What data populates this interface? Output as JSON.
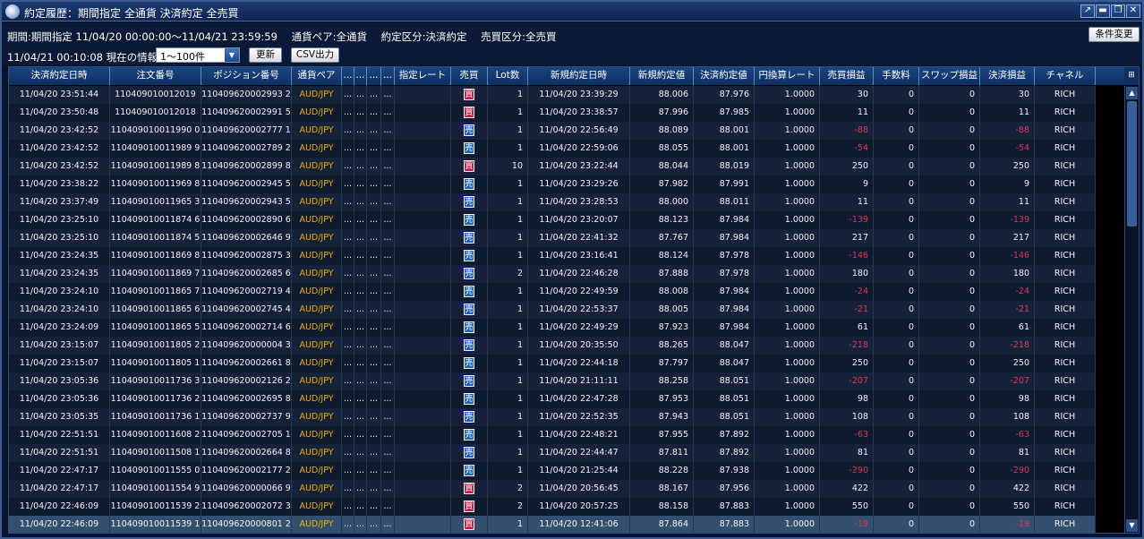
{
  "window": {
    "title": "約定履歴：期間指定 全通貨 決済約定 全売買",
    "controls": [
      "↗",
      "▬",
      "❐",
      "✕"
    ]
  },
  "info": {
    "period": "期間:期間指定  11/04/20 00:00:00〜11/04/21 23:59:59",
    "currency_pair": "通貨ペア:全通貨",
    "trade_type": "約定区分:決済約定",
    "buy_sell": "売買区分:全売買",
    "current_info": "11/04/21 00:10:08 現在の情報",
    "range_value": "1〜100件",
    "update_label": "更新",
    "csv_label": "CSV出力",
    "condition_label": "条件変更"
  },
  "columns": [
    "決済約定日時",
    "注文番号",
    "ポジション番号",
    "通貨ペア",
    "...",
    "...",
    "...",
    "...",
    "指定レート",
    "売買",
    "Lot数",
    "新規約定日時",
    "新規約定値",
    "決済約定値",
    "円換算レート",
    "売買損益",
    "手数料",
    "スワップ損益",
    "決済損益",
    "チャネル"
  ],
  "rows": [
    {
      "time": "11/04/20 23:51:44",
      "order": "110409010012019",
      "position": "110409620002993 2",
      "pair": "AUD/JPY",
      "side": "買",
      "side_type": "buy",
      "lots": "1",
      "open_time": "11/04/20 23:39:29",
      "open_price": "88.006",
      "close_price": "87.976",
      "jpy_rate": "1.0000",
      "pl": "30",
      "fee": "0",
      "swap": "0",
      "net": "30",
      "channel": "RICH"
    },
    {
      "time": "11/04/20 23:50:48",
      "order": "110409010012018",
      "position": "110409620002991 5",
      "pair": "AUD/JPY",
      "side": "買",
      "side_type": "buy",
      "lots": "1",
      "open_time": "11/04/20 23:38:57",
      "open_price": "87.996",
      "close_price": "87.985",
      "jpy_rate": "1.0000",
      "pl": "11",
      "fee": "0",
      "swap": "0",
      "net": "11",
      "channel": "RICH"
    },
    {
      "time": "11/04/20 23:42:52",
      "order": "110409010011990 0",
      "position": "110409620002777 1",
      "pair": "AUD/JPY",
      "side": "売",
      "side_type": "sell",
      "lots": "1",
      "open_time": "11/04/20 22:56:49",
      "open_price": "88.089",
      "close_price": "88.001",
      "jpy_rate": "1.0000",
      "pl": "-88",
      "fee": "0",
      "swap": "0",
      "net": "-88",
      "channel": "RICH"
    },
    {
      "time": "11/04/20 23:42:52",
      "order": "110409010011989 9",
      "position": "110409620002789 2",
      "pair": "AUD/JPY",
      "side": "売",
      "side_type": "sell",
      "lots": "1",
      "open_time": "11/04/20 22:59:06",
      "open_price": "88.055",
      "close_price": "88.001",
      "jpy_rate": "1.0000",
      "pl": "-54",
      "fee": "0",
      "swap": "0",
      "net": "-54",
      "channel": "RICH"
    },
    {
      "time": "11/04/20 23:42:52",
      "order": "110409010011989 8",
      "position": "110409620002899 8",
      "pair": "AUD/JPY",
      "side": "買",
      "side_type": "buy",
      "lots": "10",
      "open_time": "11/04/20 23:22:44",
      "open_price": "88.044",
      "close_price": "88.019",
      "jpy_rate": "1.0000",
      "pl": "250",
      "fee": "0",
      "swap": "0",
      "net": "250",
      "channel": "RICH"
    },
    {
      "time": "11/04/20 23:38:22",
      "order": "110409010011969 8",
      "position": "110409620002945 5",
      "pair": "AUD/JPY",
      "side": "売",
      "side_type": "sell",
      "lots": "1",
      "open_time": "11/04/20 23:29:26",
      "open_price": "87.982",
      "close_price": "87.991",
      "jpy_rate": "1.0000",
      "pl": "9",
      "fee": "0",
      "swap": "0",
      "net": "9",
      "channel": "RICH"
    },
    {
      "time": "11/04/20 23:37:49",
      "order": "110409010011965 3",
      "position": "110409620002943 5",
      "pair": "AUD/JPY",
      "side": "売",
      "side_type": "sell",
      "lots": "1",
      "open_time": "11/04/20 23:28:53",
      "open_price": "88.000",
      "close_price": "88.011",
      "jpy_rate": "1.0000",
      "pl": "11",
      "fee": "0",
      "swap": "0",
      "net": "11",
      "channel": "RICH"
    },
    {
      "time": "11/04/20 23:25:10",
      "order": "110409010011874 6",
      "position": "110409620002890 6",
      "pair": "AUD/JPY",
      "side": "売",
      "side_type": "sell",
      "lots": "1",
      "open_time": "11/04/20 23:20:07",
      "open_price": "88.123",
      "close_price": "87.984",
      "jpy_rate": "1.0000",
      "pl": "-139",
      "fee": "0",
      "swap": "0",
      "net": "-139",
      "channel": "RICH"
    },
    {
      "time": "11/04/20 23:25:10",
      "order": "110409010011874 5",
      "position": "110409620002646 9",
      "pair": "AUD/JPY",
      "side": "売",
      "side_type": "sell",
      "lots": "1",
      "open_time": "11/04/20 22:41:32",
      "open_price": "87.767",
      "close_price": "87.984",
      "jpy_rate": "1.0000",
      "pl": "217",
      "fee": "0",
      "swap": "0",
      "net": "217",
      "channel": "RICH"
    },
    {
      "time": "11/04/20 23:24:35",
      "order": "110409010011869 8",
      "position": "110409620002875 3",
      "pair": "AUD/JPY",
      "side": "売",
      "side_type": "sell",
      "lots": "1",
      "open_time": "11/04/20 23:16:41",
      "open_price": "88.124",
      "close_price": "87.978",
      "jpy_rate": "1.0000",
      "pl": "-146",
      "fee": "0",
      "swap": "0",
      "net": "-146",
      "channel": "RICH"
    },
    {
      "time": "11/04/20 23:24:35",
      "order": "110409010011869 7",
      "position": "110409620002685 6",
      "pair": "AUD/JPY",
      "side": "売",
      "side_type": "sell",
      "lots": "2",
      "open_time": "11/04/20 22:46:28",
      "open_price": "87.888",
      "close_price": "87.978",
      "jpy_rate": "1.0000",
      "pl": "180",
      "fee": "0",
      "swap": "0",
      "net": "180",
      "channel": "RICH"
    },
    {
      "time": "11/04/20 23:24:10",
      "order": "110409010011865 7",
      "position": "110409620002719 4",
      "pair": "AUD/JPY",
      "side": "売",
      "side_type": "sell",
      "lots": "1",
      "open_time": "11/04/20 22:49:59",
      "open_price": "88.008",
      "close_price": "87.984",
      "jpy_rate": "1.0000",
      "pl": "-24",
      "fee": "0",
      "swap": "0",
      "net": "-24",
      "channel": "RICH"
    },
    {
      "time": "11/04/20 23:24:10",
      "order": "110409010011865 6",
      "position": "110409620002745 4",
      "pair": "AUD/JPY",
      "side": "売",
      "side_type": "sell",
      "lots": "1",
      "open_time": "11/04/20 22:53:37",
      "open_price": "88.005",
      "close_price": "87.984",
      "jpy_rate": "1.0000",
      "pl": "-21",
      "fee": "0",
      "swap": "0",
      "net": "-21",
      "channel": "RICH"
    },
    {
      "time": "11/04/20 23:24:09",
      "order": "110409010011865 5",
      "position": "110409620002714 6",
      "pair": "AUD/JPY",
      "side": "売",
      "side_type": "sell",
      "lots": "1",
      "open_time": "11/04/20 22:49:29",
      "open_price": "87.923",
      "close_price": "87.984",
      "jpy_rate": "1.0000",
      "pl": "61",
      "fee": "0",
      "swap": "0",
      "net": "61",
      "channel": "RICH"
    },
    {
      "time": "11/04/20 23:15:07",
      "order": "110409010011805 2",
      "position": "110409620000004 3",
      "pair": "AUD/JPY",
      "side": "売",
      "side_type": "sell",
      "lots": "1",
      "open_time": "11/04/20 20:35:50",
      "open_price": "88.265",
      "close_price": "88.047",
      "jpy_rate": "1.0000",
      "pl": "-218",
      "fee": "0",
      "swap": "0",
      "net": "-218",
      "channel": "RICH"
    },
    {
      "time": "11/04/20 23:15:07",
      "order": "110409010011805 1",
      "position": "110409620002661 8",
      "pair": "AUD/JPY",
      "side": "売",
      "side_type": "sell",
      "lots": "1",
      "open_time": "11/04/20 22:44:18",
      "open_price": "87.797",
      "close_price": "88.047",
      "jpy_rate": "1.0000",
      "pl": "250",
      "fee": "0",
      "swap": "0",
      "net": "250",
      "channel": "RICH"
    },
    {
      "time": "11/04/20 23:05:36",
      "order": "110409010011736 3",
      "position": "110409620002126 2",
      "pair": "AUD/JPY",
      "side": "売",
      "side_type": "sell",
      "lots": "1",
      "open_time": "11/04/20 21:11:11",
      "open_price": "88.258",
      "close_price": "88.051",
      "jpy_rate": "1.0000",
      "pl": "-207",
      "fee": "0",
      "swap": "0",
      "net": "-207",
      "channel": "RICH"
    },
    {
      "time": "11/04/20 23:05:36",
      "order": "110409010011736 2",
      "position": "110409620002695 8",
      "pair": "AUD/JPY",
      "side": "売",
      "side_type": "sell",
      "lots": "1",
      "open_time": "11/04/20 22:47:28",
      "open_price": "87.953",
      "close_price": "88.051",
      "jpy_rate": "1.0000",
      "pl": "98",
      "fee": "0",
      "swap": "0",
      "net": "98",
      "channel": "RICH"
    },
    {
      "time": "11/04/20 23:05:35",
      "order": "110409010011736 1",
      "position": "110409620002737 9",
      "pair": "AUD/JPY",
      "side": "売",
      "side_type": "sell",
      "lots": "1",
      "open_time": "11/04/20 22:52:35",
      "open_price": "87.943",
      "close_price": "88.051",
      "jpy_rate": "1.0000",
      "pl": "108",
      "fee": "0",
      "swap": "0",
      "net": "108",
      "channel": "RICH"
    },
    {
      "time": "11/04/20 22:51:51",
      "order": "110409010011608 2",
      "position": "110409620002705 1",
      "pair": "AUD/JPY",
      "side": "売",
      "side_type": "sell",
      "lots": "1",
      "open_time": "11/04/20 22:48:21",
      "open_price": "87.955",
      "close_price": "87.892",
      "jpy_rate": "1.0000",
      "pl": "-63",
      "fee": "0",
      "swap": "0",
      "net": "-63",
      "channel": "RICH"
    },
    {
      "time": "11/04/20 22:51:51",
      "order": "110409010011508 1",
      "position": "110409620002664 8",
      "pair": "AUD/JPY",
      "side": "売",
      "side_type": "sell",
      "lots": "1",
      "open_time": "11/04/20 22:44:47",
      "open_price": "87.811",
      "close_price": "87.892",
      "jpy_rate": "1.0000",
      "pl": "81",
      "fee": "0",
      "swap": "0",
      "net": "81",
      "channel": "RICH"
    },
    {
      "time": "11/04/20 22:47:17",
      "order": "110409010011555 0",
      "position": "110409620002177 2",
      "pair": "AUD/JPY",
      "side": "売",
      "side_type": "sell",
      "lots": "1",
      "open_time": "11/04/20 21:25:44",
      "open_price": "88.228",
      "close_price": "87.938",
      "jpy_rate": "1.0000",
      "pl": "-290",
      "fee": "0",
      "swap": "0",
      "net": "-290",
      "channel": "RICH"
    },
    {
      "time": "11/04/20 22:47:17",
      "order": "110409010011554 9",
      "position": "110409620000066 9",
      "pair": "AUD/JPY",
      "side": "買",
      "side_type": "buy",
      "lots": "2",
      "open_time": "11/04/20 20:56:45",
      "open_price": "88.167",
      "close_price": "87.956",
      "jpy_rate": "1.0000",
      "pl": "422",
      "fee": "0",
      "swap": "0",
      "net": "422",
      "channel": "RICH"
    },
    {
      "time": "11/04/20 22:46:09",
      "order": "110409010011539 2",
      "position": "110409620002072 3",
      "pair": "AUD/JPY",
      "side": "買",
      "side_type": "buy",
      "lots": "2",
      "open_time": "11/04/20 20:57:25",
      "open_price": "88.158",
      "close_price": "87.883",
      "jpy_rate": "1.0000",
      "pl": "550",
      "fee": "0",
      "swap": "0",
      "net": "550",
      "channel": "RICH"
    },
    {
      "time": "11/04/20 22:46:09",
      "order": "110409010011539 1",
      "position": "110409620000801 2",
      "pair": "AUD/JPY",
      "side": "買",
      "side_type": "buy",
      "lots": "1",
      "open_time": "11/04/20 12:41:06",
      "open_price": "87.864",
      "close_price": "87.883",
      "jpy_rate": "1.0000",
      "pl": "-19",
      "fee": "0",
      "swap": "0",
      "net": "-19",
      "channel": "RICH"
    }
  ],
  "colors": {
    "buy": "#c0204a",
    "sell": "#1f63c9",
    "pair": "#f0b000",
    "negative": "#e0335c",
    "header": "#19457f"
  },
  "icons": {
    "app": "globe-icon",
    "column_settings": "column-settings-icon"
  }
}
